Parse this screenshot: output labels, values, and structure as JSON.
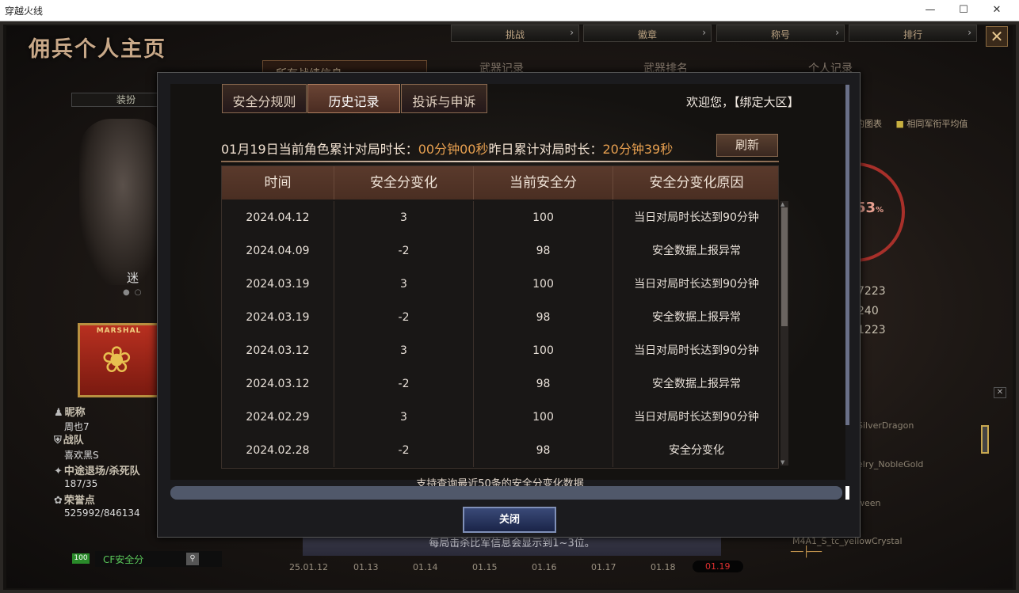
{
  "window": {
    "title": "穿越火线"
  },
  "header": {
    "page_title": "佣兵个人主页",
    "top_nav": [
      {
        "label": "挑战"
      },
      {
        "label": "徽章"
      },
      {
        "label": "称号"
      },
      {
        "label": "排行"
      }
    ],
    "bg_tabs": [
      "所有战绩信息",
      "武器记录",
      "武器排名",
      "个人记录"
    ],
    "outfit_label": "装扮"
  },
  "profile": {
    "char_label": "迷",
    "rank_label": "MARSHAL",
    "nickname_label": "昵称",
    "nickname": "周也7",
    "team_label": "战队",
    "team": "喜欢黑S",
    "quit_label": "中途退场/杀死队",
    "quit_value": "187/35",
    "honor_label": "荣誉点",
    "honor_value": "525992/846134",
    "cf_badge": "100",
    "cf_safe_label": "CF安全分"
  },
  "timeline": [
    "25.01.12",
    "01.13",
    "01.14",
    "01.15",
    "01.16",
    "01.17",
    "01.18",
    "01.19"
  ],
  "right_panel": {
    "legend1": "的图表",
    "legend2": "相同军衔平均值",
    "ring_value": "53",
    "ring_unit": "%",
    "stats": [
      "7223",
      "240",
      "1223"
    ],
    "weapons": [
      "SilverDragon",
      "elry_NobleGold",
      "ween",
      "M4A1_S_tc_yellowCrystal"
    ]
  },
  "notice": "每局击杀比军信息会显示到1~3位。",
  "modal": {
    "tabs": [
      {
        "label": "安全分规则",
        "active": false
      },
      {
        "label": "历史记录",
        "active": true
      },
      {
        "label": "投诉与申诉",
        "active": false
      }
    ],
    "welcome": "欢迎您，【绑定大区】",
    "duration": {
      "p1": "01月19日当前角色累计对局时长：",
      "v1": "00分钟00秒",
      "p2": "昨日累计对局时长：",
      "v2": "20分钟39秒"
    },
    "refresh_label": "刷新",
    "columns": [
      "时间",
      "安全分变化",
      "当前安全分",
      "安全分变化原因"
    ],
    "rows": [
      {
        "date": "2024.04.12",
        "change": "3",
        "score": "100",
        "reason": "当日对局时长达到90分钟"
      },
      {
        "date": "2024.04.09",
        "change": "-2",
        "score": "98",
        "reason": "安全数据上报异常"
      },
      {
        "date": "2024.03.19",
        "change": "3",
        "score": "100",
        "reason": "当日对局时长达到90分钟"
      },
      {
        "date": "2024.03.19",
        "change": "-2",
        "score": "98",
        "reason": "安全数据上报异常"
      },
      {
        "date": "2024.03.12",
        "change": "3",
        "score": "100",
        "reason": "当日对局时长达到90分钟"
      },
      {
        "date": "2024.03.12",
        "change": "-2",
        "score": "98",
        "reason": "安全数据上报异常"
      },
      {
        "date": "2024.02.29",
        "change": "3",
        "score": "100",
        "reason": "当日对局时长达到90分钟"
      },
      {
        "date": "2024.02.28",
        "change": "-2",
        "score": "98",
        "reason": "安全分变化"
      }
    ],
    "support_text": "支持查询最近50条的安全分变化数据",
    "close_label": "关闭"
  }
}
